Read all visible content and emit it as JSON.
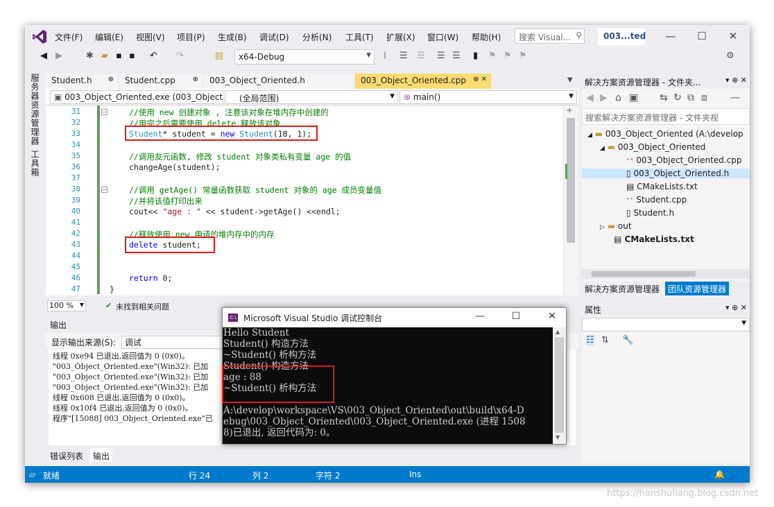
{
  "menu": {
    "items": [
      "文件(F)",
      "编辑(E)",
      "视图(V)",
      "项目(P)",
      "生成(B)",
      "调试(D)",
      "分析(N)",
      "工具(T)",
      "扩展(X)",
      "窗口(W)",
      "帮助(H)"
    ],
    "search_placeholder": "搜索 Visual...",
    "project_badge": "003...ted"
  },
  "toolbar": {
    "config": "x64-Debug"
  },
  "left_side": {
    "tabs": [
      "服务器资源管理器",
      "工具箱"
    ]
  },
  "doc_tabs": [
    {
      "label": "Student.h",
      "pin": "⊕"
    },
    {
      "label": "Student.cpp",
      "pin": "⊕"
    },
    {
      "label": "003_Object_Oriented.h",
      "pin": ""
    },
    {
      "label": "003_Object_Oriented.cpp",
      "pin": "⊕ ✕",
      "active": true
    }
  ],
  "nav": {
    "project": "003_Object_Oriented.exe (003_Object",
    "scope": "(全局范围)",
    "member": "main()"
  },
  "code": {
    "lines": [
      {
        "n": "31",
        "t": "//使用 new 创建对象 , 注意该对象在堆内存中创建的"
      },
      {
        "n": "32",
        "t": "//用完之后需要使用 delete 释放该对象"
      },
      {
        "n": "33",
        "t": "Student* student = new Student(18, 1);"
      },
      {
        "n": "34",
        "t": ""
      },
      {
        "n": "35",
        "t": "//调用友元函数, 修改 student 对象类私有变量 age 的值"
      },
      {
        "n": "36",
        "t": "changeAge(student);"
      },
      {
        "n": "37",
        "t": ""
      },
      {
        "n": "38",
        "t": "//调用 getAge() 常量函数获取 student 对象的 age 成员变量值"
      },
      {
        "n": "39",
        "t": "//并将该值打印出来"
      },
      {
        "n": "40",
        "t": "cout<< \"age : \" << student->getAge() <<endl;"
      },
      {
        "n": "41",
        "t": ""
      },
      {
        "n": "42",
        "t": "//释放使用 new 申请的堆内存中的内存"
      },
      {
        "n": "43",
        "t": "delete student;"
      },
      {
        "n": "44",
        "t": ""
      },
      {
        "n": "45",
        "t": ""
      },
      {
        "n": "46",
        "t": "return 0;"
      },
      {
        "n": "47",
        "t": "}"
      }
    ]
  },
  "editor_status": {
    "zoom": "100 %",
    "issues": "未找到相关问题"
  },
  "output": {
    "title": "输出",
    "source_label": "显示输出来源(S):",
    "source_value": "调试",
    "lines": [
      "线程 0xe94 已退出,返回值为 0 (0x0)。",
      "\"003_Object_Oriented.exe\"(Win32): 已加",
      "\"003_Object_Oriented.exe\"(Win32): 已加",
      "\"003_Object_Oriented.exe\"(Win32): 已加",
      "线程 0x608 已退出,返回值为 0 (0x0)。",
      "线程 0x10f4 已退出,返回值为 0 (0x0)。",
      "程序\"[15088] 003_Object_Oriented.exe\"已"
    ],
    "tabs": [
      "错误列表",
      "输出"
    ]
  },
  "solution_explorer": {
    "title": "解决方案资源管理器 - 文件夹...",
    "search_placeholder": "搜索解决方案资源管理器 - 文件夹视",
    "tree": [
      {
        "label": "003_Object_Oriented (A:\\develop",
        "icon": "folder-icon",
        "expander": "◢",
        "level": 0
      },
      {
        "label": "003_Object_Oriented",
        "icon": "folder-icon",
        "expander": "◢",
        "level": 1
      },
      {
        "label": "003_Object_Oriented.cpp",
        "icon": "cpp-file-icon",
        "level": 2
      },
      {
        "label": "003_Object_Oriented.h",
        "icon": "header-file-icon",
        "level": 2,
        "selected": true
      },
      {
        "label": "CMakeLists.txt",
        "icon": "text-file-icon",
        "level": 2
      },
      {
        "label": "Student.cpp",
        "icon": "cpp-file-icon",
        "level": 2
      },
      {
        "label": "Student.h",
        "icon": "header-file-icon",
        "level": 2
      },
      {
        "label": "out",
        "icon": "folder-icon",
        "expander": "▷",
        "level": 1
      },
      {
        "label": "CMakeLists.txt",
        "icon": "text-file-icon",
        "level": 1,
        "bold": true
      }
    ],
    "tabs": [
      "解决方案资源管理器",
      "团队资源管理器"
    ]
  },
  "properties": {
    "title": "属性"
  },
  "statusbar": {
    "state": "就绪",
    "row": "行 24",
    "col": "列 2",
    "char": "字符 2",
    "mode": "Ins"
  },
  "console": {
    "title": "Microsoft Visual Studio 调试控制台",
    "icon_text": "C:\\",
    "lines": [
      "Hello Student",
      "Student() 构造方法",
      "~Student() 析构方法",
      "Student() 构造方法",
      "age : 88",
      "~Student() 析构方法",
      "",
      "A:\\develop\\workspace\\VS\\003_Object_Oriented\\out\\build\\x64-D",
      "ebug\\003_Object_Oriented\\003_Object_Oriented.exe (进程 1508",
      "8)已退出, 返回代码为: 0。"
    ]
  },
  "watermark": "https://hanshuliang.blog.csdn.net",
  "colors": {
    "accent": "#007acc",
    "active_tab": "#fcdb73",
    "highlight_box": "#e01a1a"
  }
}
